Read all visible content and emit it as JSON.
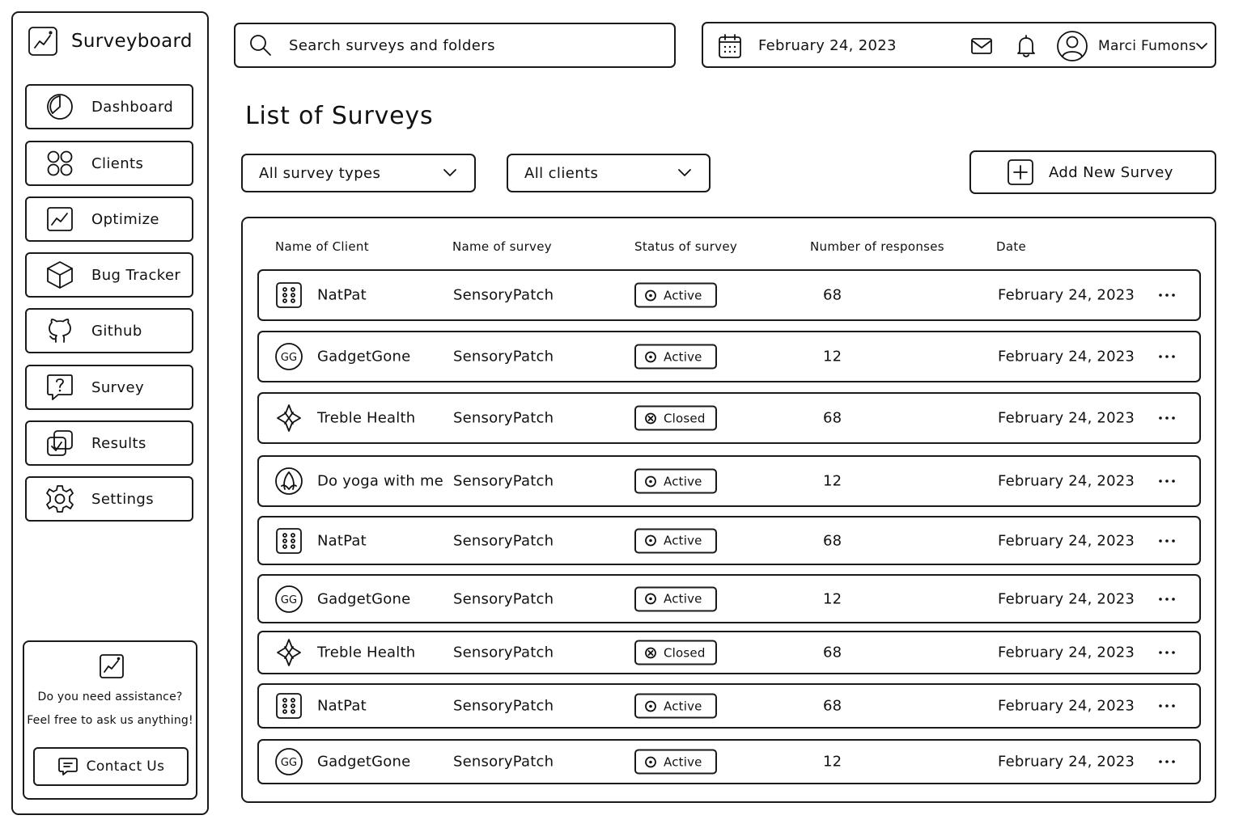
{
  "app": {
    "name": "Surveyboard"
  },
  "sidebar": {
    "items": [
      {
        "label": "Dashboard",
        "icon": "dashboard-icon"
      },
      {
        "label": "Clients",
        "icon": "clients-icon"
      },
      {
        "label": "Optimize",
        "icon": "optimize-icon"
      },
      {
        "label": "Bug Tracker",
        "icon": "cube-icon"
      },
      {
        "label": "Github",
        "icon": "github-icon"
      },
      {
        "label": "Survey",
        "icon": "question-icon"
      },
      {
        "label": "Results",
        "icon": "results-icon"
      },
      {
        "label": "Settings",
        "icon": "gear-icon"
      }
    ],
    "help": {
      "line1": "Do you need assistance?",
      "line2": "Feel free to ask us anything!",
      "button_label": "Contact Us"
    }
  },
  "header": {
    "search_placeholder": "Search surveys and folders",
    "date": "February 24, 2023",
    "user_name": "Marci Fumons"
  },
  "main": {
    "title": "List of Surveys",
    "filters": {
      "survey_type": "All survey types",
      "client": "All clients"
    },
    "add_button_label": "Add New Survey",
    "table": {
      "columns": [
        "Name of Client",
        "Name of survey",
        "Status of survey",
        "Number of responses",
        "Date"
      ],
      "rows": [
        {
          "client": "NatPat",
          "logo": "natpat-logo",
          "survey": "SensoryPatch",
          "status": "Active",
          "responses": "68",
          "date": "February 24, 2023"
        },
        {
          "client": "GadgetGone",
          "logo": "gadgetgone-logo",
          "logo_text": "GG",
          "survey": "SensoryPatch",
          "status": "Active",
          "responses": "12",
          "date": "February 24, 2023"
        },
        {
          "client": "Treble Health",
          "logo": "treble-logo",
          "survey": "SensoryPatch",
          "status": "Closed",
          "responses": "68",
          "date": "February 24, 2023"
        },
        {
          "client": "Do yoga with me",
          "logo": "yoga-logo",
          "survey": "SensoryPatch",
          "status": "Active",
          "responses": "12",
          "date": "February 24, 2023"
        },
        {
          "client": "NatPat",
          "logo": "natpat-logo",
          "survey": "SensoryPatch",
          "status": "Active",
          "responses": "68",
          "date": "February 24, 2023"
        },
        {
          "client": "GadgetGone",
          "logo": "gadgetgone-logo",
          "logo_text": "GG",
          "survey": "SensoryPatch",
          "status": "Active",
          "responses": "12",
          "date": "February 24, 2023"
        },
        {
          "client": "Treble Health",
          "logo": "treble-logo",
          "survey": "SensoryPatch",
          "status": "Closed",
          "responses": "68",
          "date": "February 24, 2023"
        },
        {
          "client": "NatPat",
          "logo": "natpat-logo",
          "survey": "SensoryPatch",
          "status": "Active",
          "responses": "68",
          "date": "February 24, 2023"
        },
        {
          "client": "GadgetGone",
          "logo": "gadgetgone-logo",
          "logo_text": "GG",
          "survey": "SensoryPatch",
          "status": "Active",
          "responses": "12",
          "date": "February 24, 2023"
        }
      ]
    }
  }
}
